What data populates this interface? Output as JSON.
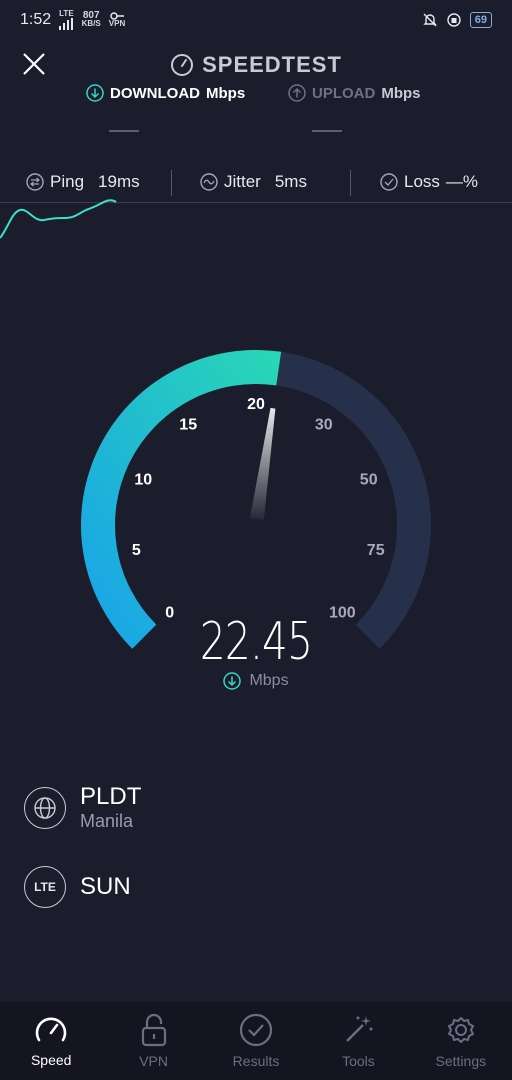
{
  "status_bar": {
    "time": "1:52",
    "lte_label": "LTE",
    "speed_value": "807",
    "speed_unit": "KB/S",
    "vpn_label": "VPN",
    "battery": "69"
  },
  "header": {
    "title": "SPEEDTEST",
    "close_icon": "close-icon",
    "title_icon": "speedometer-icon"
  },
  "modes": {
    "download_label": "DOWNLOAD",
    "download_unit": "Mbps",
    "upload_label": "UPLOAD",
    "upload_unit": "Mbps"
  },
  "stats": {
    "ping_label": "Ping",
    "ping_value": "19ms",
    "jitter_label": "Jitter",
    "jitter_value": "5ms",
    "loss_label": "Loss",
    "loss_value": "—%"
  },
  "gauge": {
    "scale": [
      "0",
      "5",
      "10",
      "15",
      "20",
      "30",
      "50",
      "75",
      "100"
    ],
    "current_value": 22.45,
    "needle_value": 22.45,
    "colors": {
      "start": "#19a4e8",
      "end": "#29d6b6",
      "track": "#26304a"
    }
  },
  "result": {
    "value": "22.45",
    "unit": "Mbps"
  },
  "server": {
    "name": "PLDT",
    "location": "Manila"
  },
  "carrier": {
    "badge": "LTE",
    "name": "SUN"
  },
  "nav": {
    "items": [
      {
        "label": "Speed",
        "icon": "speedometer-icon",
        "active": true
      },
      {
        "label": "VPN",
        "icon": "lock-icon",
        "active": false
      },
      {
        "label": "Results",
        "icon": "check-circle-icon",
        "active": false
      },
      {
        "label": "Tools",
        "icon": "magic-wand-icon",
        "active": false
      },
      {
        "label": "Settings",
        "icon": "gear-icon",
        "active": false
      }
    ]
  }
}
